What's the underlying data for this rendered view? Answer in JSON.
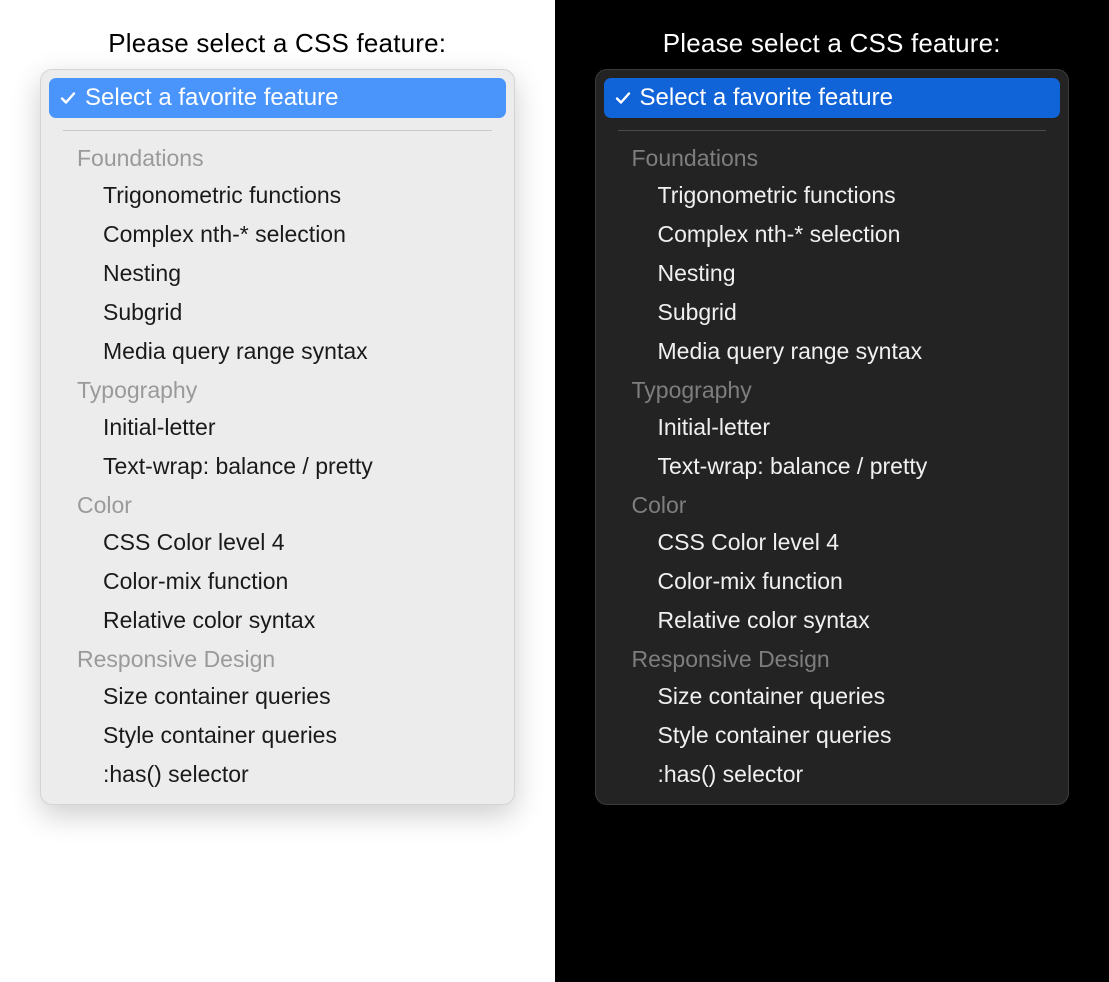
{
  "prompt": "Please select a CSS feature:",
  "selected": "Select a favorite feature",
  "colors": {
    "light_bg": "#ffffff",
    "dark_bg": "#000000",
    "light_accent": "#4a95fb",
    "dark_accent": "#1064d8"
  },
  "groups": [
    {
      "label": "Foundations",
      "items": [
        "Trigonometric functions",
        "Complex nth-* selection",
        "Nesting",
        "Subgrid",
        "Media query range syntax"
      ]
    },
    {
      "label": "Typography",
      "items": [
        "Initial-letter",
        "Text-wrap: balance / pretty"
      ]
    },
    {
      "label": "Color",
      "items": [
        "CSS Color level 4",
        "Color-mix function",
        "Relative color syntax"
      ]
    },
    {
      "label": "Responsive Design",
      "items": [
        "Size container queries",
        "Style container queries",
        ":has() selector"
      ]
    }
  ]
}
